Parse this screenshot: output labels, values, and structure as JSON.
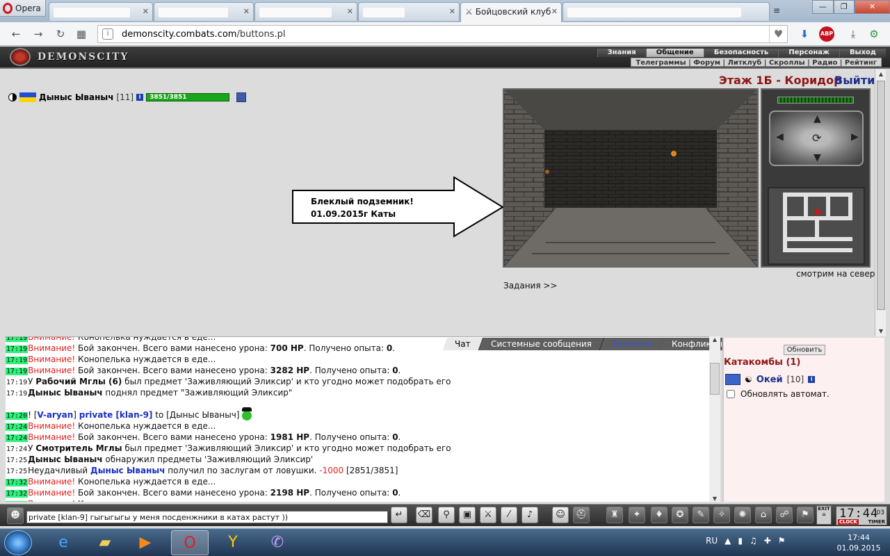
{
  "browser": {
    "menu_label": "Opera",
    "active_tab_title": "Бойцовский клуб",
    "url_domain": "demonscity.combats.com",
    "url_path": "/buttons.pl",
    "abp_label": "ABP"
  },
  "game": {
    "logo_text": "DEMONSCITY",
    "top_menu": [
      "Знания",
      "Общение",
      "Безопасность",
      "Персонаж",
      "Выход"
    ],
    "top_menu_selected": "Общение",
    "sub_menu": "Телеграммы | Форум | Литклуб | Скроллы | Радио | Рейтинг",
    "location": "Этаж 1Б - Коридор",
    "exit_label": "Выйти",
    "look_direction": "смотрим на север",
    "tasks_link": "Задания >>",
    "player": {
      "name": "Дыныс Ываныч",
      "level": "[11]",
      "hp_text": "3851/3851",
      "hp_fraction": 1.0
    },
    "annotation": {
      "line1": "Блеклый подземник!",
      "line2": "01.09.2015г Каты"
    }
  },
  "chat": {
    "tabs": [
      "Чат",
      "Системные сообщения",
      "Торговля",
      "Конфликты"
    ],
    "lines": [
      {
        "time": "17:19",
        "green": true,
        "parts": [
          {
            "c": "warn",
            "t": "Внимание!"
          },
          {
            "c": "",
            "t": " Конопелька нуждается в еде..."
          }
        ]
      },
      {
        "time": "17:19",
        "green": true,
        "parts": [
          {
            "c": "warn",
            "t": "Внимание!"
          },
          {
            "c": "",
            "t": " Бой закончен. Всего вами нанесено урона: "
          },
          {
            "c": "b",
            "t": "700 HP"
          },
          {
            "c": "",
            "t": ". Получено опыта: "
          },
          {
            "c": "b",
            "t": "0"
          },
          {
            "c": "",
            "t": "."
          }
        ]
      },
      {
        "time": "17:19",
        "green": true,
        "parts": [
          {
            "c": "warn",
            "t": "Внимание!"
          },
          {
            "c": "",
            "t": " Конопелька нуждается в еде..."
          }
        ]
      },
      {
        "time": "17:19",
        "green": true,
        "parts": [
          {
            "c": "warn",
            "t": "Внимание!"
          },
          {
            "c": "",
            "t": " Бой закончен. Всего вами нанесено урона: "
          },
          {
            "c": "b",
            "t": "3282 HP"
          },
          {
            "c": "",
            "t": ". Получено опыта: "
          },
          {
            "c": "b",
            "t": "0"
          },
          {
            "c": "",
            "t": "."
          }
        ]
      },
      {
        "time": "17:19",
        "green": false,
        "parts": [
          {
            "c": "",
            "t": "У "
          },
          {
            "c": "b",
            "t": "Рабочий Мглы (6)"
          },
          {
            "c": "",
            "t": " был предмет 'Заживляющий Эликсир' и кто угодно может подобрать его"
          }
        ]
      },
      {
        "time": "17:19",
        "green": false,
        "parts": [
          {
            "c": "b",
            "t": "Дыныс Ываныч"
          },
          {
            "c": "",
            "t": " поднял предмет \"Заживляющий Эликсир\""
          }
        ]
      },
      {
        "time": "",
        "green": false,
        "parts": []
      },
      {
        "time": "17:20",
        "green": true,
        "parts": [
          {
            "c": "",
            "t": "! ["
          },
          {
            "c": "blue",
            "t": "V-aryan"
          },
          {
            "c": "",
            "t": "] "
          },
          {
            "c": "blue",
            "t": "private [klan-9]"
          },
          {
            "c": "",
            "t": " to [Дыныс Ываныч] "
          }
        ],
        "smile": true
      },
      {
        "time": "17:24",
        "green": true,
        "parts": [
          {
            "c": "warn",
            "t": "Внимание!"
          },
          {
            "c": "",
            "t": " Конопелька нуждается в еде..."
          }
        ]
      },
      {
        "time": "17:24",
        "green": true,
        "parts": [
          {
            "c": "warn",
            "t": "Внимание!"
          },
          {
            "c": "",
            "t": " Бой закончен. Всего вами нанесено урона: "
          },
          {
            "c": "b",
            "t": "1981 HP"
          },
          {
            "c": "",
            "t": ". Получено опыта: "
          },
          {
            "c": "b",
            "t": "0"
          },
          {
            "c": "",
            "t": "."
          }
        ]
      },
      {
        "time": "17:24",
        "green": false,
        "parts": [
          {
            "c": "",
            "t": "У "
          },
          {
            "c": "b",
            "t": "Смотритель Мглы"
          },
          {
            "c": "",
            "t": " был предмет 'Заживляющий Эликсир' и кто угодно может подобрать его"
          }
        ]
      },
      {
        "time": "17:25",
        "green": false,
        "parts": [
          {
            "c": "b",
            "t": "Дыныс Ываныч"
          },
          {
            "c": "",
            "t": " обнаружил предметы 'Заживляющий Эликсир'"
          }
        ]
      },
      {
        "time": "17:25",
        "green": false,
        "parts": [
          {
            "c": "",
            "t": "Неудачливый "
          },
          {
            "c": "blue",
            "t": "Дыныс Ываныч"
          },
          {
            "c": "",
            "t": " получил по заслугам от ловушки. "
          },
          {
            "c": "warn",
            "t": "-1000"
          },
          {
            "c": "",
            "t": " [2851/3851]"
          }
        ]
      },
      {
        "time": "17:32",
        "green": true,
        "parts": [
          {
            "c": "warn",
            "t": "Внимание!"
          },
          {
            "c": "",
            "t": " Конопелька нуждается в еде..."
          }
        ]
      },
      {
        "time": "17:32",
        "green": true,
        "parts": [
          {
            "c": "warn",
            "t": "Внимание!"
          },
          {
            "c": "",
            "t": " Бой закончен. Всего вами нанесено урона: "
          },
          {
            "c": "b",
            "t": "2198 HP"
          },
          {
            "c": "",
            "t": ". Получено опыта: "
          },
          {
            "c": "b",
            "t": "0"
          },
          {
            "c": "",
            "t": "."
          }
        ]
      },
      {
        "time": "17:33",
        "green": true,
        "parts": [
          {
            "c": "warn",
            "t": "Внимание!"
          },
          {
            "c": "",
            "t": " Конопелька нуждается в еде..."
          }
        ]
      }
    ],
    "input_value": "private [klan-9] гыгыгыгы у меня посденжники в катах растут ))"
  },
  "side": {
    "refresh_label": "Обновить",
    "title": "Катакомбы (1)",
    "user_name": "Окей",
    "user_level": "[10]",
    "auto_refresh_label": "Обновлять автомат."
  },
  "game_clock": {
    "time": "17:44",
    "seconds": "03",
    "label_clock": "CLOCK",
    "label_timer": "TIMER",
    "exit_label": "EXIT"
  },
  "taskbar": {
    "lang": "RU",
    "time": "17:44",
    "date": "01.09.2015"
  }
}
